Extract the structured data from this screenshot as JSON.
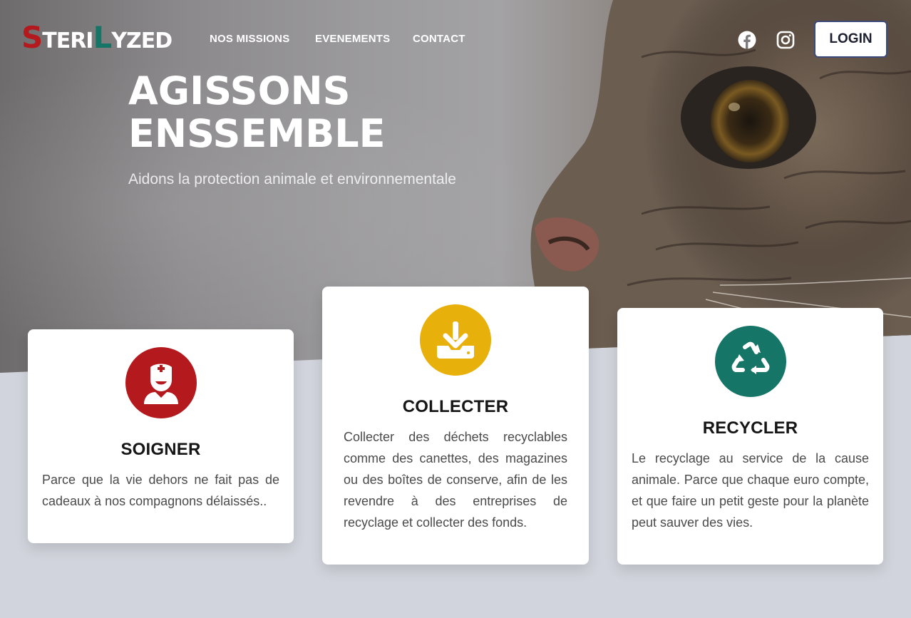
{
  "brand": {
    "logo_s": "S",
    "logo_teri": "TERI",
    "logo_l": "L",
    "logo_yzed": "YZED",
    "accent_red": "#b3191d",
    "accent_green": "#157566"
  },
  "nav": {
    "links": [
      {
        "label": "NOS MISSIONS"
      },
      {
        "label": "EVENEMENTS"
      },
      {
        "label": "CONTACT"
      }
    ],
    "social": [
      {
        "icon": "facebook-icon"
      },
      {
        "icon": "instagram-icon"
      }
    ],
    "login_label": "LOGIN"
  },
  "hero": {
    "title_line1": "AGISSONS",
    "title_line2": "ENSSEMBLE",
    "subtitle": "Aidons la protection animale et environnementale"
  },
  "cards": [
    {
      "title": "SOIGNER",
      "text": "Parce que la vie dehors ne fait pas de cadeaux à nos compagnons délaissés..",
      "icon": "nurse-icon",
      "color": "#b3191d"
    },
    {
      "title": "COLLECTER",
      "text": "Collecter des déchets recyclables comme des canettes, des magazines ou des boîtes de conserve, afin de les revendre à des entreprises de recyclage et collecter des fonds.",
      "icon": "download-inbox-icon",
      "color": "#e8b00b"
    },
    {
      "title": "RECYCLER",
      "text": "Le recyclage au service de la cause animale. Parce que chaque euro compte, et que faire un petit geste pour la planète peut sauver des vies.",
      "icon": "recycle-icon",
      "color": "#157566"
    }
  ]
}
